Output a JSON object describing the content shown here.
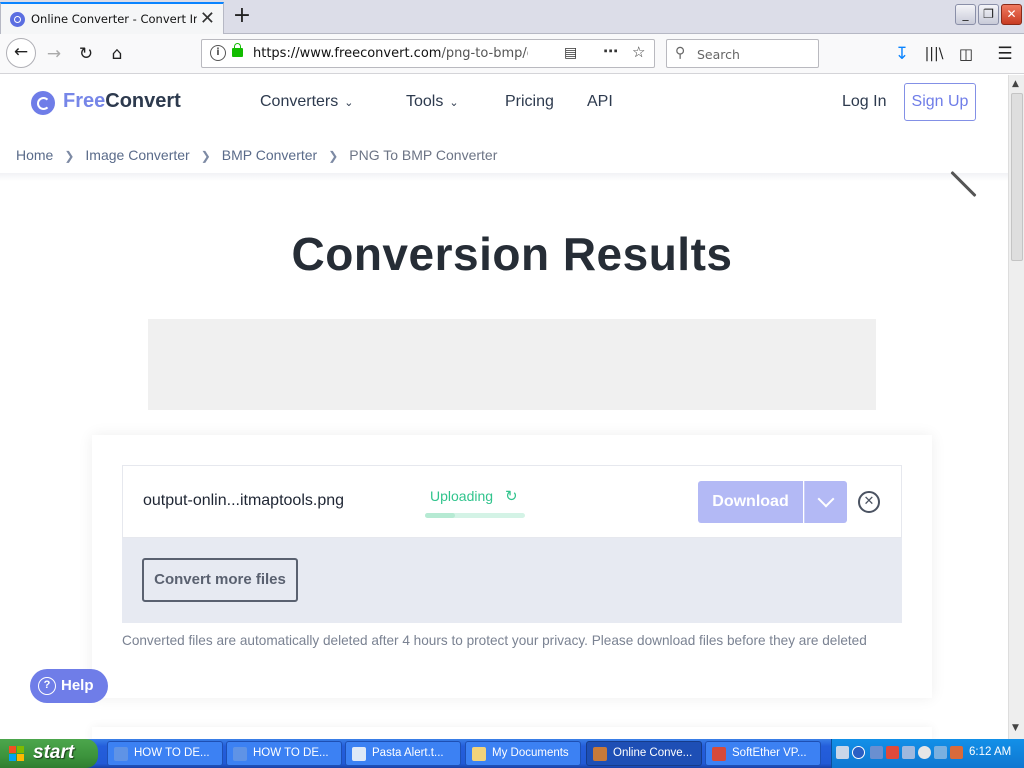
{
  "browser": {
    "tab_title": "Online Converter - Convert Image",
    "tab_close": "✕",
    "new_tab": "+",
    "url_host": "https://www.freeconvert.com",
    "url_path": "/png-to-bmp/dow",
    "search_placeholder": "Search",
    "window_buttons": [
      "_",
      "❐",
      "✕"
    ]
  },
  "site": {
    "logo_free": "Free",
    "logo_convert": "Convert",
    "nav": [
      {
        "label": "Converters",
        "dropdown": true
      },
      {
        "label": "Tools",
        "dropdown": true
      },
      {
        "label": "Pricing",
        "dropdown": false
      },
      {
        "label": "API",
        "dropdown": false
      }
    ],
    "login": "Log In",
    "signup": "Sign Up",
    "breadcrumb": [
      "Home",
      "Image Converter",
      "BMP Converter",
      "PNG To BMP Converter"
    ]
  },
  "main": {
    "title": "Conversion Results",
    "file": {
      "name": "output-onlin...itmaptools.png",
      "status": "Uploading",
      "progress": 0.3,
      "download_label": "Download"
    },
    "convert_more": "Convert more files",
    "notice": "Converted files are automatically deleted after 4 hours to protect your privacy. Please download files before they are deleted"
  },
  "help": {
    "label": "Help"
  },
  "taskbar": {
    "start": "start",
    "tasks": [
      {
        "label": "HOW TO DE...",
        "icon_color": "#5f93e6",
        "active": false
      },
      {
        "label": "HOW TO DE...",
        "icon_color": "#5f93e6",
        "active": false
      },
      {
        "label": "Pasta Alert.t...",
        "icon_color": "#dfe9f7",
        "active": false
      },
      {
        "label": "My Documents",
        "icon_color": "#f2d37a",
        "active": false
      },
      {
        "label": "Online Conve...",
        "icon_color": "#c87a3a",
        "active": true
      },
      {
        "label": "SoftEther VP...",
        "icon_color": "#d64a3a",
        "active": false
      }
    ],
    "clock": "6:12 AM"
  },
  "colors": {
    "accent": "#6f7de8",
    "success": "#31c48d",
    "download_disabled": "#b3b9f5"
  }
}
